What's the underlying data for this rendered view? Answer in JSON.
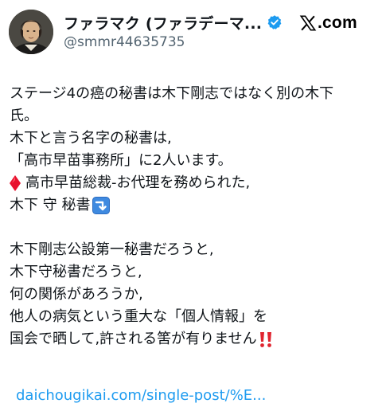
{
  "post": {
    "author": {
      "display_name": "ファラマク (ファラデーマ...",
      "handle": "@smmr44635735",
      "avatar_icon": "portrait-avatar",
      "verified_icon": "verified-badge-icon"
    },
    "brand": {
      "icon": "x-logo-icon",
      "text": ".com"
    },
    "lines": [
      "ステージ4の癌の秘書は木下剛志ではなく別の木下",
      "氏。",
      "木下と言う名字の秘書は,",
      "「高市早苗事務所」に2人います。",
      "高市早苗総裁-お代理を務められた,",
      "木下 守 秘書",
      "",
      "木下剛志公設第一秘書だろうと,",
      "木下守秘書だろうと,",
      "何の関係があろうか,",
      "他人の病気という重大な「個人情報」を",
      "国会で晒して,許される筈が有りません"
    ],
    "link_text": "daichougikai.com/single-post/%E...",
    "emoji": {
      "diamond": "red-diamond-icon",
      "arrow": "arrow-down-right-icon",
      "bang": "double-exclamation-icon"
    },
    "colors": {
      "text": "#0f1419",
      "handle": "#536471",
      "link": "#1d9bf0",
      "verified": "#1d9bf0",
      "diamond": "#e8112d",
      "arrow_bg": "#3f8ae0",
      "bang": "#e0242f"
    }
  }
}
